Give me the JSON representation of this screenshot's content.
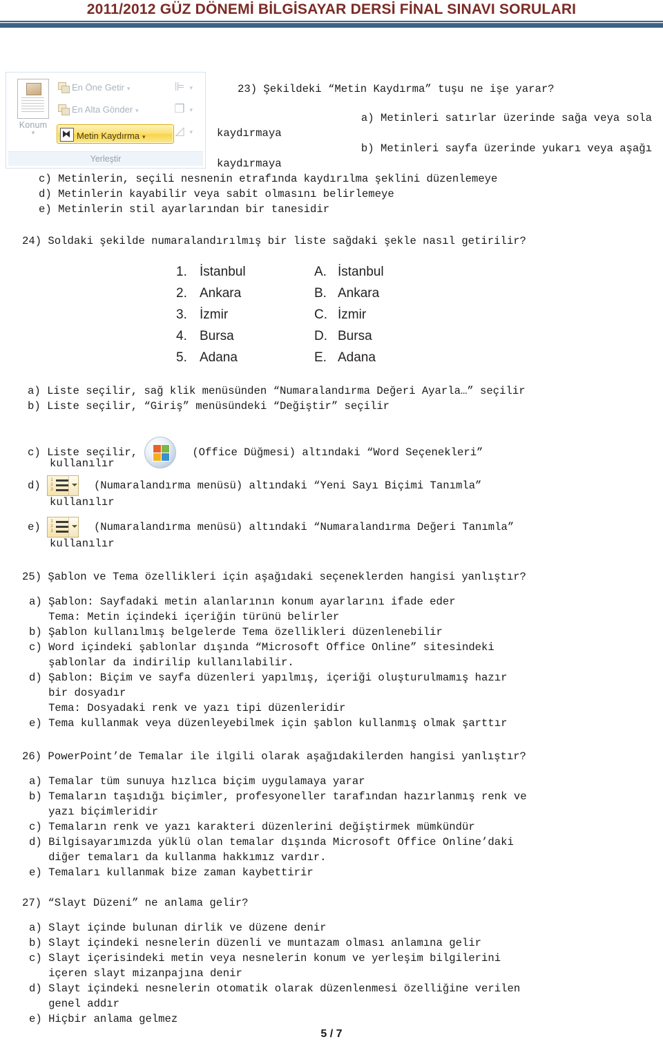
{
  "header": {
    "title": "2011/2012 GÜZ DÖNEMİ BİLGİSAYAR DERSİ FİNAL SINAVI SORULARI",
    "rule_color": "#3f6184",
    "title_color": "#7a2b25"
  },
  "ribbon_figure": {
    "position_label": "Konum",
    "bring_front_label": "En Öne Getir",
    "send_back_label": "En Alta Gönder",
    "text_wrap_label": "Metin Kaydırma",
    "group_caption": "Yerleştir",
    "align_icon": "align-icon",
    "group_icon": "group-objects-icon",
    "rotate_icon": "rotate-icon",
    "highlight_color": "#f8d44c"
  },
  "questions": [
    {
      "number": "23)",
      "stem": "23) Şekildeki “Metin Kaydırma” tuşu ne işe yarar?",
      "options": [
        {
          "label": "a)",
          "lines": [
            "a) Metinleri satırlar üzerinde sağa veya sola",
            "kaydırmaya"
          ]
        },
        {
          "label": "b)",
          "lines": [
            "b) Metinleri sayfa üzerinde yukarı veya aşağı",
            "kaydırmaya"
          ]
        },
        {
          "label": "c)",
          "lines": [
            "c) Metinlerin, seçili nesnenin etrafında kaydırılma şeklini düzenlemeye"
          ]
        },
        {
          "label": "d)",
          "lines": [
            "d) Metinlerin kayabilir veya sabit olmasını belirlemeye"
          ]
        },
        {
          "label": "e)",
          "lines": [
            "e) Metinlerin stil ayarlarından bir tanesidir"
          ]
        }
      ]
    },
    {
      "number": "24)",
      "stem": "24) Soldaki şekilde numaralandırılmış bir liste sağdaki şekle nasıl getirilir?",
      "figure": {
        "left_list": {
          "markers": [
            "1.",
            "2.",
            "3.",
            "4.",
            "5."
          ],
          "items": [
            "İstanbul",
            "Ankara",
            "İzmir",
            "Bursa",
            "Adana"
          ]
        },
        "right_list": {
          "markers": [
            "A.",
            "B.",
            "C.",
            "D.",
            "E."
          ],
          "items": [
            "İstanbul",
            "Ankara",
            "İzmir",
            "Bursa",
            "Adana"
          ]
        }
      },
      "options": [
        {
          "label": "a)",
          "text": "a) Liste seçilir, sağ klik menüsünden “Numaralandırma Değeri Ayarla…” seçilir"
        },
        {
          "label": "b)",
          "text": "b) Liste seçilir, “Giriş” menüsündeki “Değiştir” seçilir"
        },
        {
          "label": "c)",
          "prefix": "c) Liste seçilir,",
          "icon": "office-button-icon",
          "text": "(Office Düğmesi) altındaki “Word Seçenekleri”",
          "cont": "kullanılır"
        },
        {
          "label": "d)",
          "prefix": "d)",
          "icon": "numbering-menu-icon",
          "text": "(Numaralandırma menüsü) altındaki “Yeni Sayı Biçimi Tanımla”",
          "cont": "kullanılır"
        },
        {
          "label": "e)",
          "prefix": "e)",
          "icon": "numbering-menu-icon",
          "text": "(Numaralandırma menüsü) altındaki “Numaralandırma Değeri Tanımla”",
          "cont": "kullanılır"
        }
      ]
    },
    {
      "number": "25)",
      "stem": "25) Şablon ve Tema özellikleri için aşağıdaki seçeneklerden hangisi yanlıştır?",
      "options": [
        {
          "label": "a)",
          "lines": [
            "a) Şablon: Sayfadaki metin alanlarının konum ayarlarını ifade eder",
            "   Tema: Metin içindeki içeriğin türünü belirler"
          ]
        },
        {
          "label": "b)",
          "lines": [
            "b) Şablon kullanılmış belgelerde Tema özellikleri düzenlenebilir"
          ]
        },
        {
          "label": "c)",
          "lines": [
            "c) Word içindeki şablonlar dışında “Microsoft Office Online” sitesindeki",
            "   şablonlar da indirilip kullanılabilir."
          ]
        },
        {
          "label": "d)",
          "lines": [
            "d) Şablon: Biçim ve sayfa düzenleri yapılmış, içeriği oluşturulmamış hazır",
            "   bir dosyadır",
            "   Tema: Dosyadaki renk ve yazı tipi düzenleridir"
          ]
        },
        {
          "label": "e)",
          "lines": [
            "e) Tema kullanmak veya düzenleyebilmek için şablon kullanmış olmak şarttır"
          ]
        }
      ]
    },
    {
      "number": "26)",
      "stem": "26) PowerPoint’de Temalar ile ilgili olarak aşağıdakilerden hangisi yanlıştır?",
      "options": [
        {
          "label": "a)",
          "lines": [
            "a) Temalar tüm sunuya hızlıca biçim uygulamaya yarar"
          ]
        },
        {
          "label": "b)",
          "lines": [
            "b) Temaların taşıdığı biçimler, profesyoneller tarafından hazırlanmış renk ve",
            "   yazı biçimleridir"
          ]
        },
        {
          "label": "c)",
          "lines": [
            "c) Temaların renk ve yazı karakteri düzenlerini değiştirmek mümkündür"
          ]
        },
        {
          "label": "d)",
          "lines": [
            "d) Bilgisayarımızda yüklü olan temalar dışında Microsoft Office Online’daki",
            "   diğer temaları da kullanma hakkımız vardır."
          ]
        },
        {
          "label": "e)",
          "lines": [
            "e) Temaları kullanmak bize zaman kaybettirir"
          ]
        }
      ]
    },
    {
      "number": "27)",
      "stem": "27) “Slayt Düzeni” ne anlama gelir?",
      "options": [
        {
          "label": "a)",
          "lines": [
            "a) Slayt içinde bulunan dirlik ve düzene denir"
          ]
        },
        {
          "label": "b)",
          "lines": [
            "b) Slayt içindeki nesnelerin düzenli ve muntazam olması anlamına gelir"
          ]
        },
        {
          "label": "c)",
          "lines": [
            "c) Slayt içerisindeki metin veya nesnelerin konum ve yerleşim bilgilerini",
            "   içeren slayt mizanpajına denir"
          ]
        },
        {
          "label": "d)",
          "lines": [
            "d) Slayt içindeki nesnelerin otomatik olarak düzenlenmesi özelliğine verilen",
            "   genel addır"
          ]
        },
        {
          "label": "e)",
          "lines": [
            "e) Hiçbir anlama gelmez"
          ]
        }
      ]
    }
  ],
  "footer": {
    "page": "5 / 7"
  }
}
